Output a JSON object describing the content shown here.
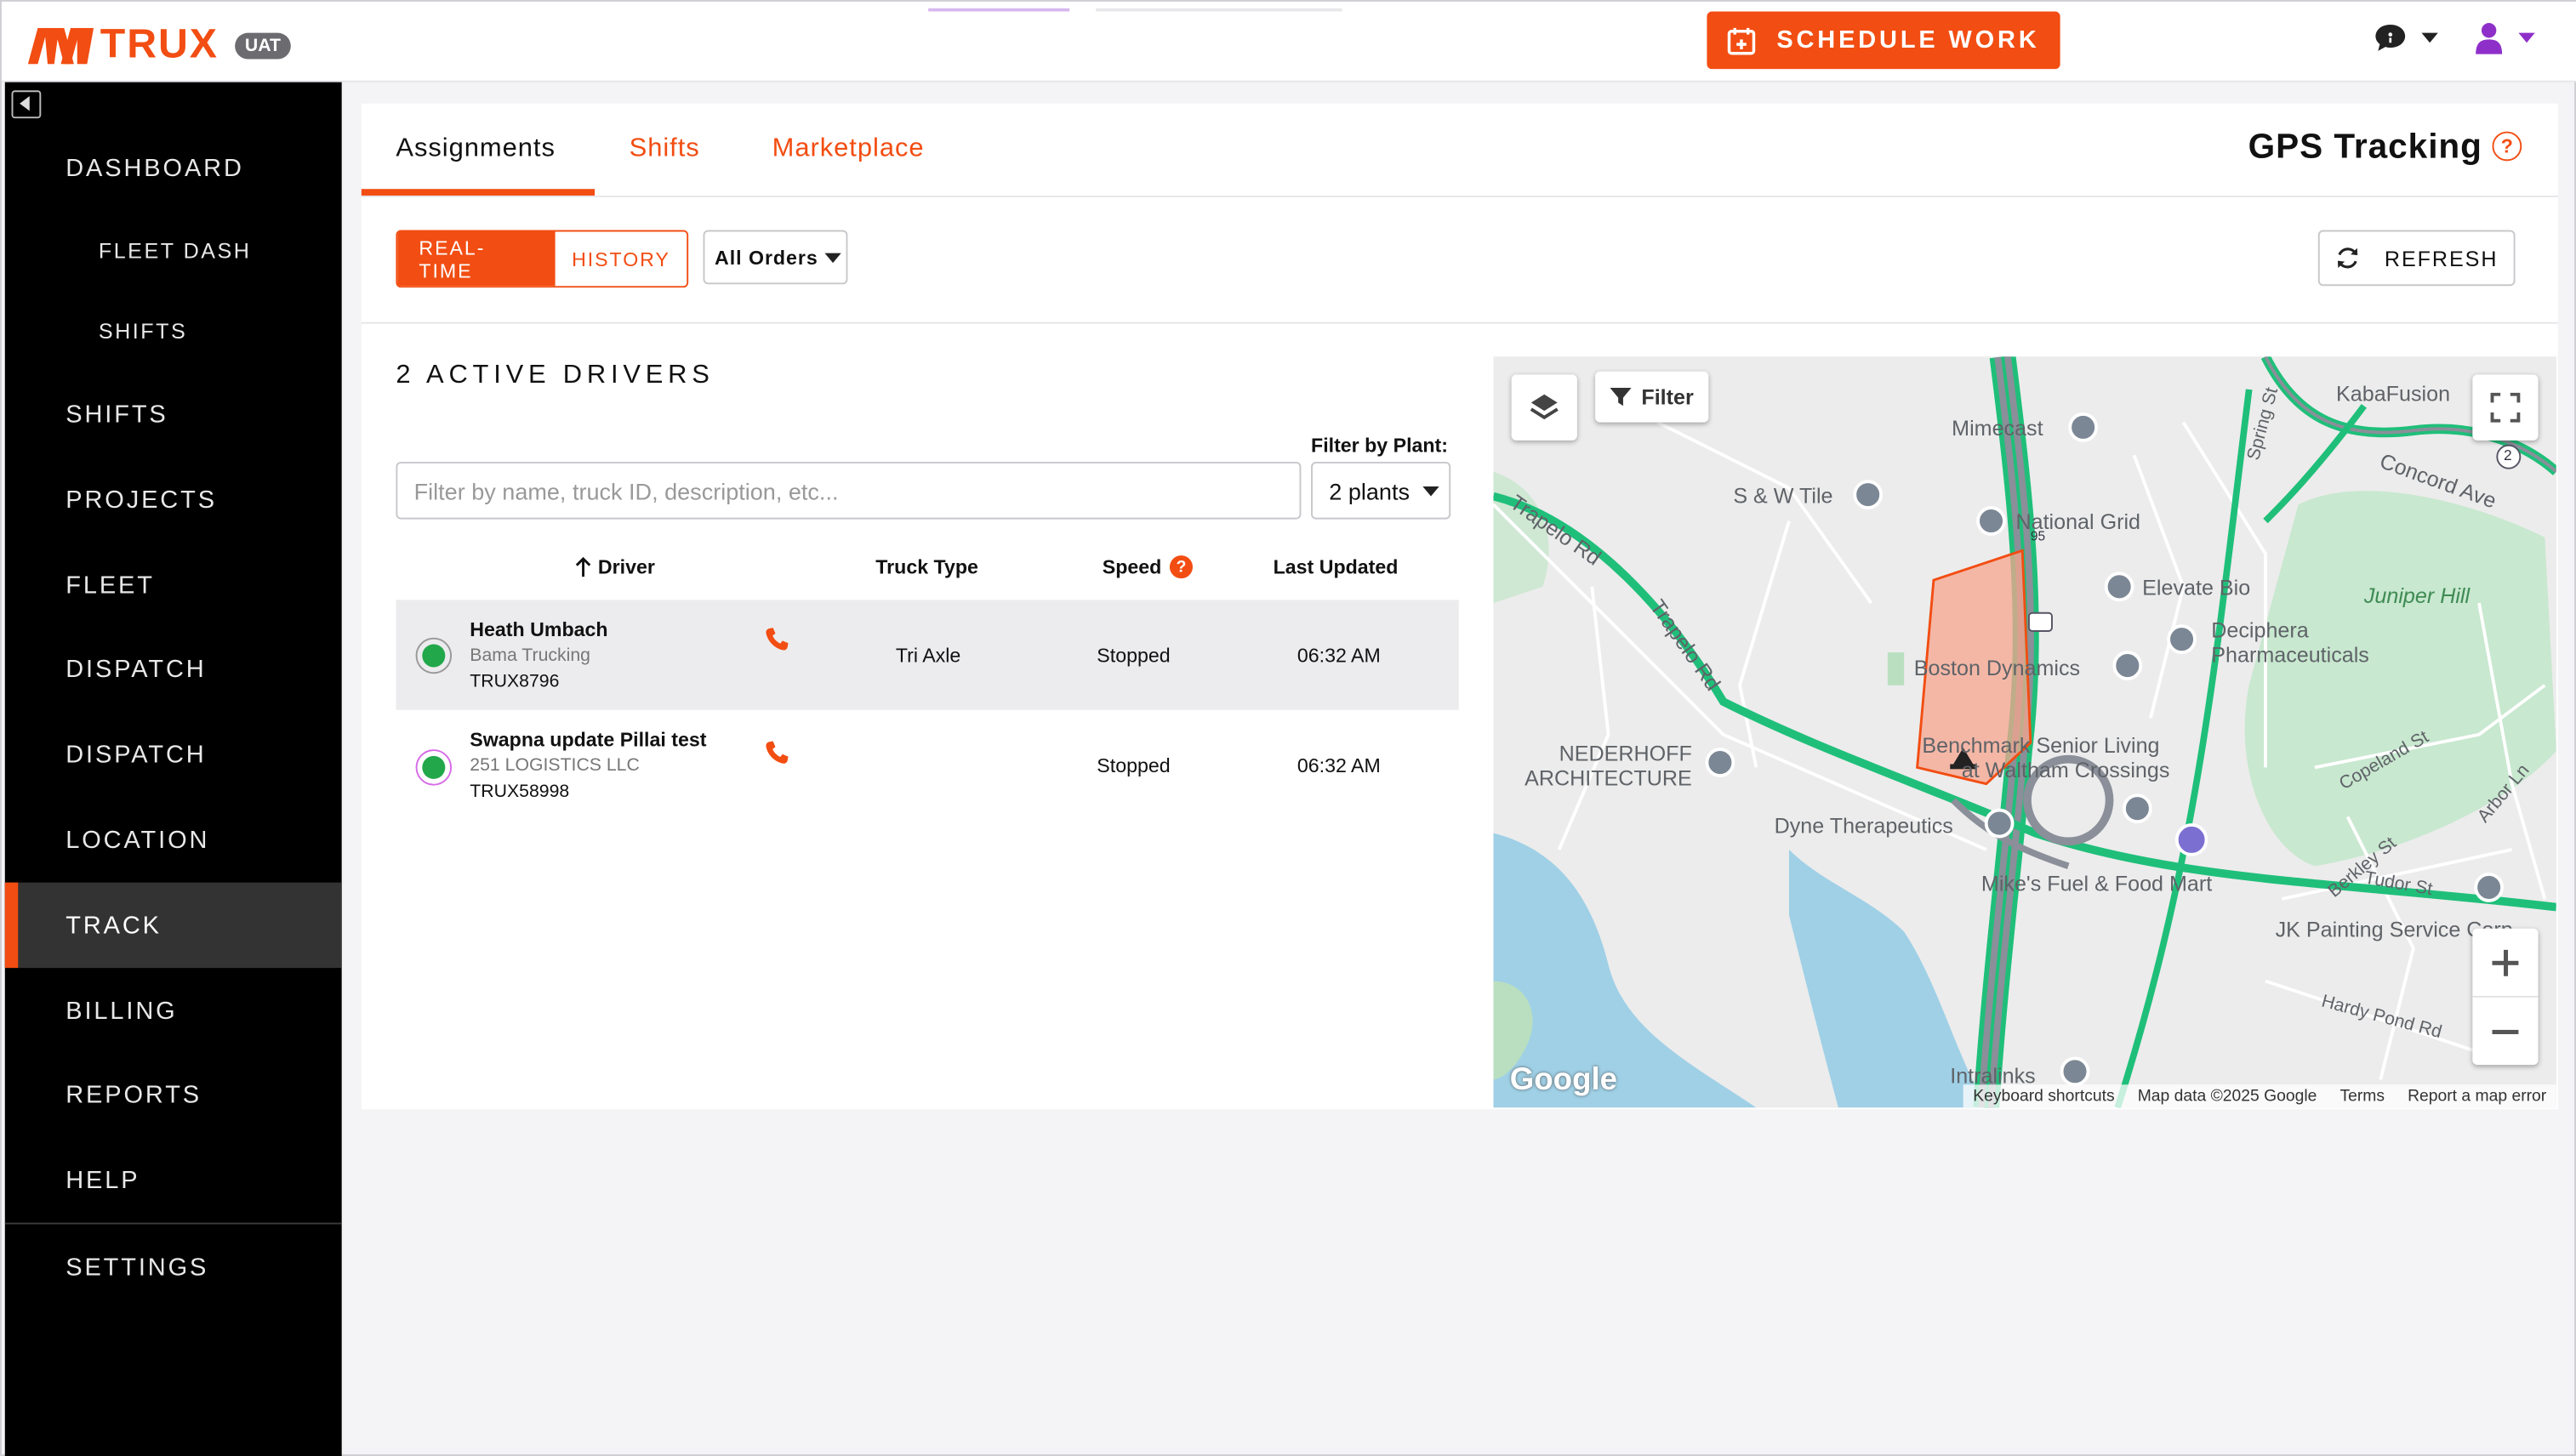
{
  "app": {
    "brand": "TRUX",
    "env_badge": "UAT",
    "brand_color": "#f24d12"
  },
  "topbar": {
    "schedule_label": "SCHEDULE WORK",
    "chat_icon": "chat-bubble-icon",
    "user_icon": "user-icon"
  },
  "sidebar": {
    "items": [
      {
        "label": "DASHBOARD"
      },
      {
        "label": "FLEET DASH"
      },
      {
        "label": "SHIFTS"
      },
      {
        "label": "SHIFTS"
      },
      {
        "label": "PROJECTS"
      },
      {
        "label": "FLEET"
      },
      {
        "label": "DISPATCH"
      },
      {
        "label": "DISPATCH"
      },
      {
        "label": "LOCATION"
      },
      {
        "label": "TRACK"
      },
      {
        "label": "BILLING"
      },
      {
        "label": "REPORTS"
      },
      {
        "label": "HELP"
      },
      {
        "label": "SETTINGS"
      }
    ]
  },
  "tabs": {
    "assignments": "Assignments",
    "shifts": "Shifts",
    "marketplace": "Marketplace"
  },
  "page": {
    "title": "GPS Tracking",
    "help": "?"
  },
  "controls": {
    "realtime": "REAL-TIME",
    "history": "HISTORY",
    "orders": "All Orders",
    "refresh": "REFRESH"
  },
  "drivers": {
    "heading": "2 ACTIVE DRIVERS",
    "filter_plant_label": "Filter by Plant:",
    "search_placeholder": "Filter by name, truck ID, description, etc...",
    "plants_value": "2 plants",
    "columns": {
      "driver": "Driver",
      "truck_type": "Truck Type",
      "speed": "Speed",
      "speed_help": "?",
      "last_updated": "Last Updated"
    },
    "rows": [
      {
        "name": "Heath Umbach",
        "company": "Bama Trucking",
        "truck": "TRUX8796",
        "truck_type": "Tri Axle",
        "speed": "Stopped",
        "updated": "06:32 AM"
      },
      {
        "name": "Swapna update Pillai test",
        "company": "251 LOGISTICS LLC",
        "truck": "TRUX58998",
        "truck_type": "",
        "speed": "Stopped",
        "updated": "06:32 AM"
      }
    ]
  },
  "map": {
    "filter": "Filter",
    "labels": {
      "mimecast": "Mimecast",
      "kabafusion": "KabaFusion",
      "sw_tile": "S & W Tile",
      "national_grid": "National Grid",
      "concord": "Concord Ave",
      "trapelo1": "Trapelo Rd",
      "trapelo2": "Trapelo Rd",
      "elevate": "Elevate Bio",
      "juniper": "Juniper Hill",
      "deciphera": "Deciphera",
      "deciphera2": "Pharmaceuticals",
      "boston_dynamics": "Boston Dynamics",
      "nederhoff": "NEDERHOFF",
      "nederhoff2": "ARCHITECTURE",
      "benchmark": "Benchmark Senior Living",
      "benchmark2": "at Waltham Crossings",
      "dyne": "Dyne Therapeutics",
      "mikes": "Mike's Fuel & Food Mart",
      "jk": "JK Painting Service Corp",
      "intralinks": "Intralinks",
      "copeland": "Copeland St",
      "arbor": "Arbor Ln",
      "berkley": "Berkley St",
      "tudor": "Tudor St",
      "hardy": "Hardy Pond Rd",
      "spring": "Spring St",
      "highway": "95",
      "route": "2"
    },
    "footer": {
      "shortcuts": "Keyboard shortcuts",
      "data": "Map data ©2025 Google",
      "terms": "Terms",
      "report": "Report a map error"
    },
    "google": "Google"
  }
}
